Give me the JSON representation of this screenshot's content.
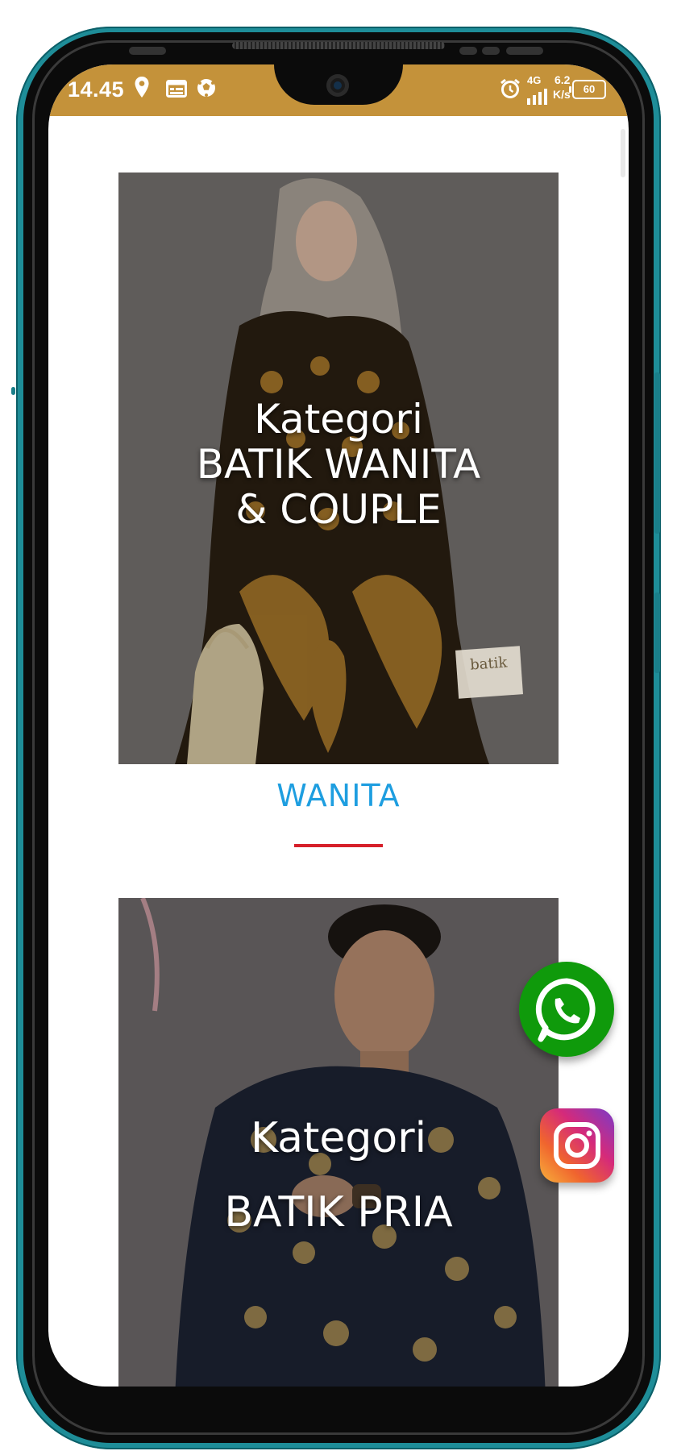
{
  "status_bar": {
    "time": "14.45",
    "network": "4G",
    "speed_value": "6.2",
    "speed_unit": "K/s",
    "battery": "60",
    "icons": [
      "location-icon",
      "calendar-icon",
      "soccer-ball-icon",
      "alarm-icon",
      "signal-icon"
    ],
    "background_color": "#c4923a"
  },
  "categories": [
    {
      "overlay_line_1": "Kategori",
      "overlay_line_2": "BATIK WANITA",
      "overlay_line_3": "& COUPLE",
      "title": "WANITA",
      "title_color": "#1e9ee0",
      "divider_color": "#d61f2a"
    },
    {
      "overlay_line_1": "Kategori",
      "overlay_line_2": "BATIK PRIA"
    }
  ],
  "floating_buttons": [
    {
      "icon": "whatsapp-icon",
      "color": "#0f9a0b"
    },
    {
      "icon": "instagram-icon"
    }
  ]
}
